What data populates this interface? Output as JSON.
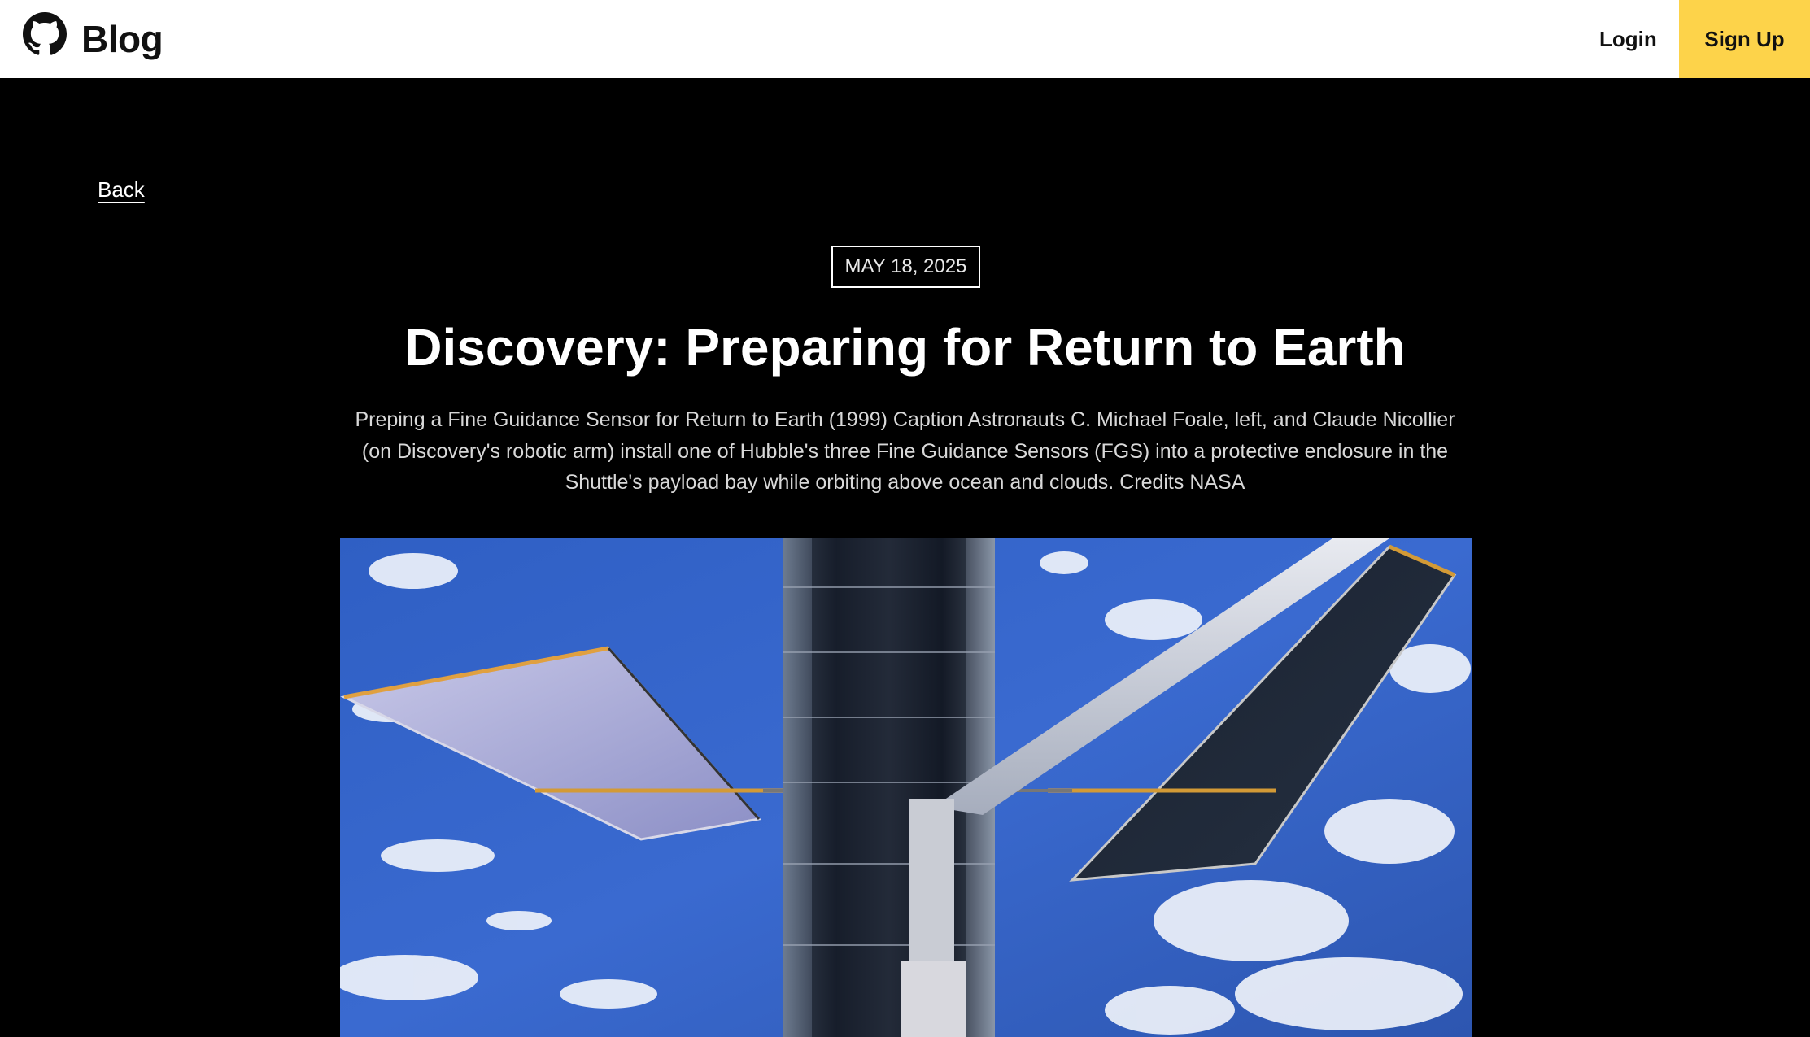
{
  "header": {
    "brand": "Blog",
    "logo_icon": "github-octocat-icon",
    "login_label": "Login",
    "signup_label": "Sign Up",
    "signup_color": "#fdd34a"
  },
  "article": {
    "back_label": "Back",
    "date": "MAY 18, 2025",
    "title": "Discovery: Preparing for Return to Earth",
    "caption": "Preping a Fine Guidance Sensor for Return to Earth (1999) Caption Astronauts C. Michael Foale, left, and Claude Nicollier (on Discovery's robotic arm) install one of Hubble's three Fine Guidance Sensors (FGS) into a protective enclosure in the Shuttle's payload bay while orbiting above ocean and clouds. Credits NASA",
    "image_icon": "hubble-telescope-photo"
  }
}
